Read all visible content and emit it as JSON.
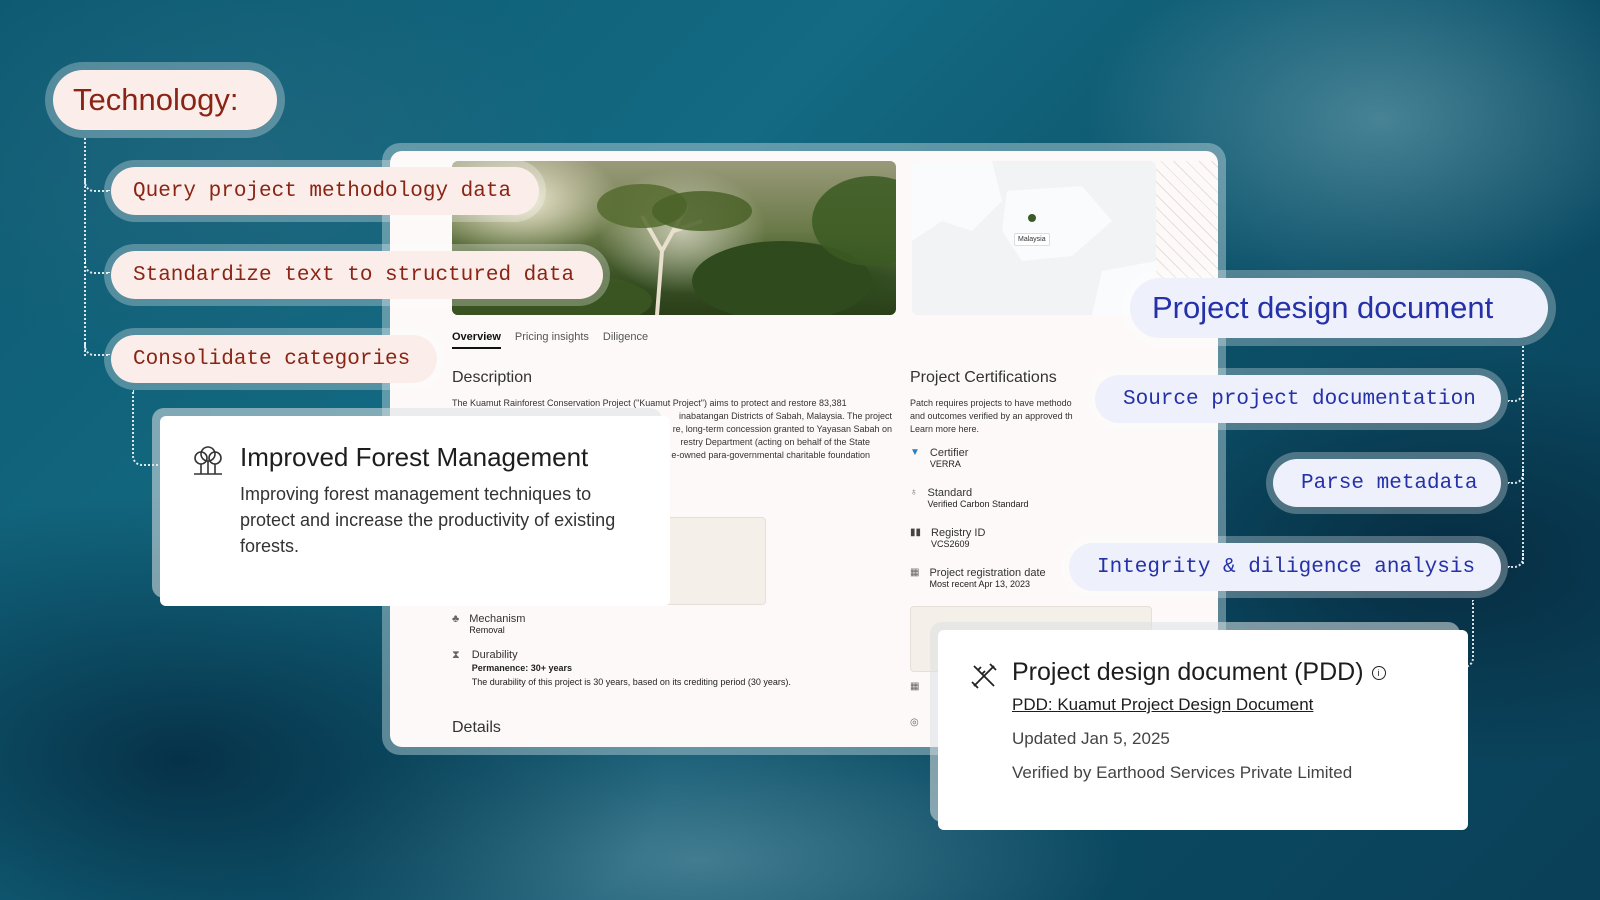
{
  "left": {
    "heading": "Technology:",
    "steps": [
      "Query project methodology data",
      "Standardize text to structured data",
      "Consolidate categories"
    ]
  },
  "right": {
    "heading": "Project design document",
    "steps": [
      "Source project documentation",
      "Parse metadata",
      "Integrity & diligence analysis"
    ]
  },
  "window": {
    "map_label": "Malaysia",
    "tabs": [
      "Overview",
      "Pricing insights",
      "Diligence"
    ],
    "description_title": "Description",
    "description_lines": [
      "The Kuamut Rainforest Conservation Project (\"Kuamut Project\") aims to protect and restore 83,381",
      "inabatangan Districts of Sabah, Malaysia. The project",
      "re, long-term concession granted to Yayasan Sabah on",
      "restry Department (acting on behalf of the State",
      "e-owned para-governmental charitable foundation"
    ],
    "mechanism_label": "Mechanism",
    "mechanism_value": "Removal",
    "durability_label": "Durability",
    "durability_value": "Permanence: 30+ years",
    "durability_note": "The durability of this project is 30 years, based on its crediting period (30 years).",
    "details_title": "Details",
    "certs_title": "Project Certifications",
    "certs_lines": [
      "Patch requires projects to have methodo",
      "and outcomes verified by an approved th",
      "Learn more here."
    ],
    "certs": [
      {
        "label": "Certifier",
        "value": "VERRA"
      },
      {
        "label": "Standard",
        "value": "Verified Carbon Standard"
      },
      {
        "label": "Registry ID",
        "value": "VCS2609"
      },
      {
        "label": "Project registration date",
        "value": "Most recent Apr 13, 2023"
      }
    ]
  },
  "ifm_card": {
    "title": "Improved Forest Management",
    "body": "Improving forest management techniques to protect and increase the productivity of existing forests."
  },
  "pdd_card": {
    "title": "Project design document (PDD)",
    "link": "PDD: Kuamut Project Design Document",
    "updated": "Updated Jan 5, 2025",
    "verified": "Verified by Earthood Services Private Limited"
  },
  "colors": {
    "left_accent": "#8a2414",
    "right_accent": "#2431a8"
  }
}
